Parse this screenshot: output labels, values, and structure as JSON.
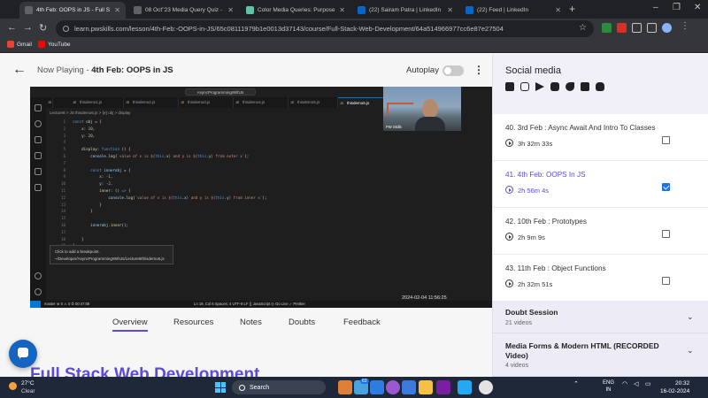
{
  "browser": {
    "tabs": [
      {
        "title": "4th Feb: OOPS in JS - Full S",
        "active": true,
        "icon_color": "#3c4043"
      },
      {
        "title": "08 Oct''23 Media Query Quiz -",
        "active": false,
        "icon_color": "#3c4043"
      },
      {
        "title": "Color Media Queries: Purpose",
        "active": false,
        "icon_color": "#61c3a6"
      },
      {
        "title": "(22) Sairam Patra | LinkedIn",
        "active": false,
        "icon_color": "#0a66c2"
      },
      {
        "title": "(22) Feed | LinkedIn",
        "active": false,
        "icon_color": "#0a66c2"
      }
    ],
    "url": "learn.pwskills.com/lesson/4th-Feb:-OOPS-in-JS/65c08111979b1e0013d37143/course/Full-Stack-Web-Development/64a514966977cc6e87e27504",
    "bookmarks": [
      {
        "label": "Gmail",
        "icon": "gmail-icon",
        "color": "#ea4335"
      },
      {
        "label": "YouTube",
        "icon": "youtube-icon",
        "color": "#ff0000"
      }
    ]
  },
  "player": {
    "now_playing_prefix": "Now Playing - ",
    "now_playing_title": "4th Feb: OOPS in JS",
    "autoplay_label": "Autoplay",
    "autoplay_on": false,
    "video_timestamp": "2024-02-04  11:56:25",
    "webcam_label": "PW Skills"
  },
  "editor": {
    "search_text": "AsyncProgrammingWithJs",
    "tabs": [
      "thisdemo1.js",
      "thisdemo2.js",
      "thisdemo3.js",
      "thisdemo4.js",
      "thisdemo5.js",
      "thisdemo6.js"
    ],
    "active_tab": "thisdemo6.js",
    "breadcrumb": "Lecture8 > JS thisdemo6.js > {e} obj > display",
    "hover_line1": "Click to add a breakpoint.",
    "hover_line2": "~/Developer/AsyncProgrammingWithJs/Lecture8/thisdemo6.js",
    "status_left": "master  ⊗ 0 ⚠ 0   ⏱ 00:47:08",
    "status_right": "Ln 19, Col 6   Spaces: 4   UTF-8   LF   {} JavaScript   ◎ Go Live   ✓ Prettier"
  },
  "content_tabs": [
    "Overview",
    "Resources",
    "Notes",
    "Doubts",
    "Feedback"
  ],
  "active_content_tab": "Overview",
  "course_title": "Full Stack Web Development",
  "sidebar": {
    "social_title": "Social media",
    "social_icons": [
      "facebook-icon",
      "instagram-icon",
      "telegram-icon",
      "youtube-icon",
      "twitter-icon",
      "linkedin-icon",
      "discord-icon"
    ],
    "lectures": [
      {
        "title": "40. 3rd Feb : Async Await And Intro To Classes",
        "duration": "3h 32m 33s",
        "checked": false,
        "current": false
      },
      {
        "title": "41. 4th Feb: OOPS In JS",
        "duration": "2h 56m 4s",
        "checked": true,
        "current": true
      },
      {
        "title": "42. 10th Feb : Prototypes",
        "duration": "2h 9m 9s",
        "checked": false,
        "current": false
      },
      {
        "title": "43. 11th Feb : Object Functions",
        "duration": "2h 32m 51s",
        "checked": false,
        "current": false
      }
    ],
    "sections": [
      {
        "title": "Doubt Session",
        "subtitle": "21 videos"
      },
      {
        "title": "Media Forms & Modern HTML (RECORDED Video)",
        "subtitle": "4 videos"
      }
    ]
  },
  "taskbar": {
    "temperature": "27°C",
    "weather": "Clear",
    "search_label": "Search",
    "badge": "63",
    "lang_line1": "ENG",
    "lang_line2": "IN",
    "time": "20:32",
    "date": "16-02-2024"
  }
}
